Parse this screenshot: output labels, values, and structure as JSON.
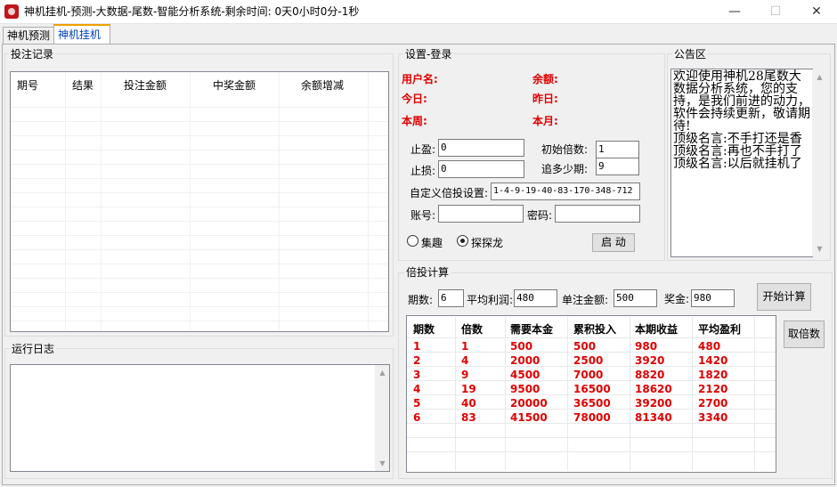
{
  "window": {
    "title": "神机挂机-预测-大数据-尾数-智能分析系统-剩余时间:  0天0小时0分-1秒",
    "minimize": "—",
    "maximize": "☐",
    "close": "✕"
  },
  "tabs": [
    {
      "label": "神机预测"
    },
    {
      "label": "神机挂机"
    }
  ],
  "bet_record": {
    "title": "投注记录",
    "columns": [
      "期号",
      "结果",
      "投注金额",
      "中奖金额",
      "余额增减"
    ]
  },
  "run_log": {
    "title": "运行日志"
  },
  "settings": {
    "title": "设置-登录",
    "username_label": "用户名:",
    "balance_label": "余额:",
    "today_label": "今日:",
    "yesterday_label": "昨日:",
    "week_label": "本周:",
    "month_label": "本月:",
    "take_profit_label": "止盈:",
    "take_profit_value": "0",
    "stop_loss_label": "止损:",
    "stop_loss_value": "0",
    "init_mult_label": "初始倍数:",
    "init_mult_value": "1",
    "chase_label": "追多少期:",
    "chase_value": "9",
    "custom_label": "自定义倍投设置:",
    "custom_value": "1-4-9-19-40-83-170-348-712",
    "account_label": "账号:",
    "account_value": "",
    "password_label": "密码:",
    "password_value": "",
    "radio1_label": "集趣",
    "radio2_label": "探探龙",
    "start_button": "启 动"
  },
  "notice": {
    "title": "公告区",
    "lines": [
      "欢迎使用神机28尾数大数据分析系统，您的支持，是我们前进的动力，软件会持续更新，敬请期待!",
      "顶级名言:不手打还是香",
      "顶级名言:再也不手打了",
      "顶级名言:以后就挂机了"
    ]
  },
  "calc": {
    "title": "倍投计算",
    "periods_label": "期数:",
    "periods_value": "6",
    "avg_profit_label": "平均利润:",
    "avg_profit_value": "480",
    "unit_amount_label": "单注金额:",
    "unit_amount_value": "500",
    "prize_label": "奖金:",
    "prize_value": "980",
    "start_calc_button": "开始计算",
    "take_mult_button": "取倍数",
    "columns": [
      "期数",
      "倍数",
      "需要本金",
      "累积投入",
      "本期收益",
      "平均盈利"
    ],
    "rows": [
      [
        "1",
        "1",
        "500",
        "500",
        "980",
        "480"
      ],
      [
        "2",
        "4",
        "2000",
        "2500",
        "3920",
        "1420"
      ],
      [
        "3",
        "9",
        "4500",
        "7000",
        "8820",
        "1820"
      ],
      [
        "4",
        "19",
        "9500",
        "16500",
        "18620",
        "2120"
      ],
      [
        "5",
        "40",
        "20000",
        "36500",
        "39200",
        "2700"
      ],
      [
        "6",
        "83",
        "41500",
        "78000",
        "81340",
        "3340"
      ]
    ]
  },
  "colors": {
    "accent_red": "#e00000",
    "active_tab_text": "#0040c0",
    "active_tab_border": "#f0a000"
  }
}
